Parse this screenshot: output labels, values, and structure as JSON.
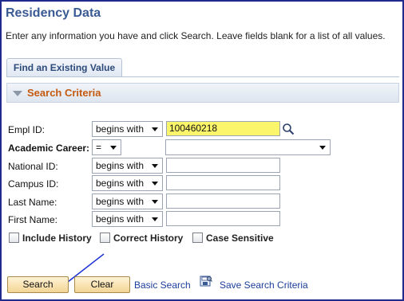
{
  "page": {
    "title": "Residency Data",
    "instructions": "Enter any information you have and click Search. Leave fields blank for a list of all values."
  },
  "tabs": [
    {
      "label": "Find an Existing Value"
    }
  ],
  "section": {
    "title": "Search Criteria"
  },
  "fields": [
    {
      "label": "Empl ID:",
      "operator": "begins with",
      "value": "100460218"
    },
    {
      "label": "Academic Career:",
      "operator": "=",
      "value": ""
    },
    {
      "label": "National ID:",
      "operator": "begins with",
      "value": ""
    },
    {
      "label": "Campus ID:",
      "operator": "begins with",
      "value": ""
    },
    {
      "label": "Last Name:",
      "operator": "begins with",
      "value": ""
    },
    {
      "label": "First Name:",
      "operator": "begins with",
      "value": ""
    }
  ],
  "checkboxes": [
    {
      "label": "Include History",
      "checked": false
    },
    {
      "label": "Correct History",
      "checked": false
    },
    {
      "label": "Case Sensitive",
      "checked": false
    }
  ],
  "actions": {
    "search": "Search",
    "clear": "Clear",
    "basic_search": "Basic Search",
    "save_search": "Save Search Criteria"
  },
  "colors": {
    "title": "#3a5a93",
    "section_title": "#c45a10",
    "highlight_field": "#fbf56b",
    "link": "#1b3e9a",
    "frame": "#1f2a8c"
  }
}
